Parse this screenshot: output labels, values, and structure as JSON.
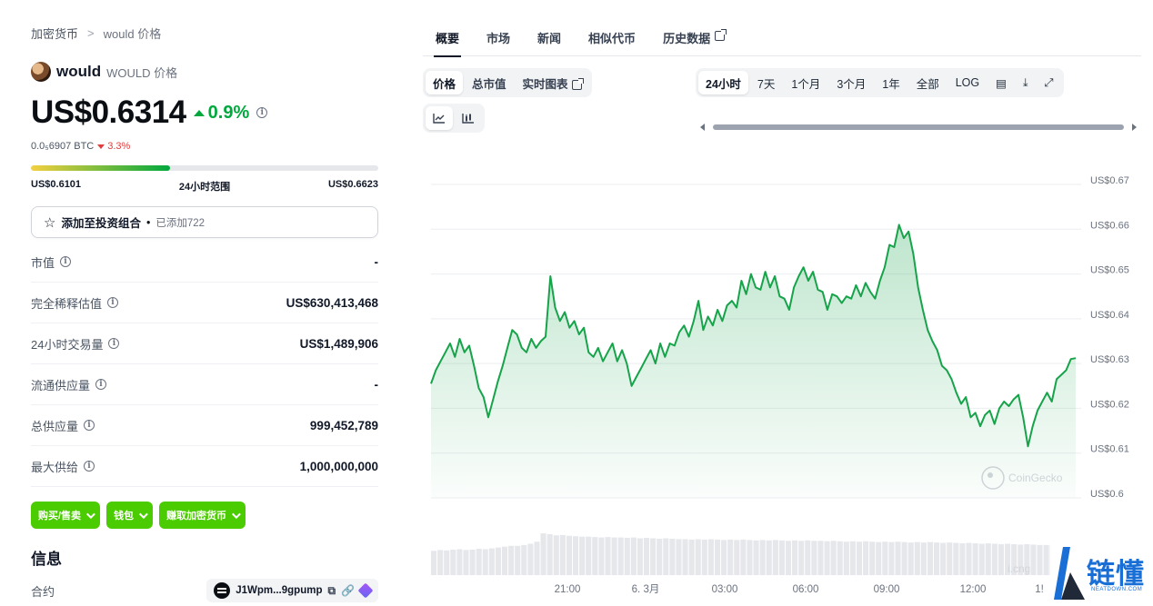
{
  "breadcrumb": {
    "root": "加密货币",
    "sep": ">",
    "current": "would 价格"
  },
  "coin": {
    "name": "would",
    "symbol": "WOULD 价格"
  },
  "price": {
    "value": "US$0.6314",
    "change": "0.9%",
    "btc_value": "0.0₅6907 BTC",
    "btc_change": "3.3%"
  },
  "range": {
    "low": "US$0.6101",
    "label": "24小时范围",
    "high": "US$0.6623",
    "position_pct": 40
  },
  "portfolio": {
    "label": "添加至投资组合",
    "dot": "•",
    "added": "已添加722"
  },
  "stats": [
    {
      "label": "市值",
      "value": "-"
    },
    {
      "label": "完全稀释估值",
      "value": "US$630,413,468"
    },
    {
      "label": "24小时交易量",
      "value": "US$1,489,906"
    },
    {
      "label": "流通供应量",
      "value": "-"
    },
    {
      "label": "总供应量",
      "value": "999,452,789"
    },
    {
      "label": "最大供给",
      "value": "1,000,000,000"
    }
  ],
  "actions": {
    "buy_sell": "购买/售卖",
    "wallet": "钱包",
    "earn": "赚取加密货币"
  },
  "info": {
    "title": "信息",
    "contract_label": "合约",
    "contract_value": "J1Wpm...9gpump"
  },
  "tabs": [
    {
      "label": "概要"
    },
    {
      "label": "市场"
    },
    {
      "label": "新闻"
    },
    {
      "label": "相似代币"
    },
    {
      "label": "历史数据"
    }
  ],
  "chart_modes": {
    "price": "价格",
    "market_cap": "总市值",
    "live": "实时图表"
  },
  "ranges": [
    "24小时",
    "7天",
    "1个月",
    "3个月",
    "1年",
    "全部",
    "LOG"
  ],
  "watermark": {
    "brand": "CoinGecko",
    "site": "链懂",
    "site_sub": "NEATDOWN.COM",
    "partial": "i.cng"
  },
  "colors": {
    "accent_green": "#00a83e",
    "button_green": "#4bcc00",
    "negative_red": "#e03e3e",
    "line_green": "#16a34a"
  },
  "chart_data": {
    "type": "area",
    "title": "",
    "ylim": [
      0.6,
      0.67
    ],
    "y_ticks": [
      "US$0.67",
      "US$0.66",
      "US$0.65",
      "US$0.64",
      "US$0.63",
      "US$0.62",
      "US$0.61",
      "US$0.6"
    ],
    "y_tick_values": [
      0.67,
      0.66,
      0.65,
      0.64,
      0.63,
      0.62,
      0.61,
      0.6
    ],
    "x_ticks": [
      "21:00",
      "6. 3月",
      "03:00",
      "06:00",
      "09:00",
      "12:00",
      "1!"
    ],
    "values": [
      0.6255,
      0.6285,
      0.6305,
      0.6325,
      0.6345,
      0.6315,
      0.6355,
      0.6325,
      0.634,
      0.6295,
      0.6245,
      0.6225,
      0.618,
      0.622,
      0.626,
      0.6295,
      0.6335,
      0.6375,
      0.6365,
      0.6335,
      0.6325,
      0.6355,
      0.6335,
      0.635,
      0.636,
      0.6495,
      0.6425,
      0.6395,
      0.6415,
      0.638,
      0.6395,
      0.6365,
      0.638,
      0.6325,
      0.6315,
      0.6335,
      0.6305,
      0.6325,
      0.6345,
      0.6305,
      0.633,
      0.63,
      0.625,
      0.627,
      0.629,
      0.631,
      0.633,
      0.63,
      0.6345,
      0.6315,
      0.6345,
      0.634,
      0.637,
      0.6385,
      0.636,
      0.6395,
      0.644,
      0.6375,
      0.6405,
      0.6385,
      0.642,
      0.6395,
      0.643,
      0.644,
      0.6425,
      0.6485,
      0.6455,
      0.65,
      0.647,
      0.6465,
      0.6505,
      0.647,
      0.6495,
      0.645,
      0.6445,
      0.642,
      0.647,
      0.6495,
      0.6515,
      0.6485,
      0.6505,
      0.6465,
      0.646,
      0.642,
      0.6455,
      0.645,
      0.6435,
      0.645,
      0.6445,
      0.6475,
      0.645,
      0.648,
      0.646,
      0.6445,
      0.6485,
      0.6515,
      0.6565,
      0.656,
      0.661,
      0.658,
      0.6595,
      0.6545,
      0.647,
      0.642,
      0.6375,
      0.635,
      0.633,
      0.6295,
      0.6285,
      0.6265,
      0.6235,
      0.621,
      0.6225,
      0.618,
      0.619,
      0.616,
      0.6185,
      0.6195,
      0.6165,
      0.62,
      0.6215,
      0.6205,
      0.622,
      0.623,
      0.618,
      0.6115,
      0.616,
      0.6195,
      0.6215,
      0.6235,
      0.6215,
      0.6265,
      0.6275,
      0.6285,
      0.631,
      0.6312
    ]
  },
  "volume_data": {
    "type": "bar",
    "note_levels": [
      0.58,
      0.6,
      0.59,
      0.61,
      0.62,
      0.6,
      0.61,
      0.63,
      0.62,
      0.64,
      0.66,
      0.68,
      0.7,
      0.7,
      0.72,
      0.75,
      0.8,
      1.0,
      0.98,
      0.95,
      0.96,
      0.94,
      0.93,
      0.92,
      0.92,
      0.91,
      0.9,
      0.91,
      0.9,
      0.9,
      0.89,
      0.9,
      0.88,
      0.89,
      0.88,
      0.87,
      0.88,
      0.87,
      0.86,
      0.86,
      0.85,
      0.86,
      0.85,
      0.86,
      0.85,
      0.84,
      0.85,
      0.84,
      0.85,
      0.84,
      0.83,
      0.84,
      0.83,
      0.84,
      0.83,
      0.82,
      0.83,
      0.82,
      0.83,
      0.82,
      0.82,
      0.81,
      0.82,
      0.81,
      0.8,
      0.81,
      0.8,
      0.81,
      0.8,
      0.79,
      0.8,
      0.79,
      0.8,
      0.79,
      0.78,
      0.79,
      0.78,
      0.79,
      0.78,
      0.77,
      0.78,
      0.77,
      0.76,
      0.77,
      0.76,
      0.75,
      0.76,
      0.75,
      0.74,
      0.75,
      0.74,
      0.73,
      0.74,
      0.73,
      0.72,
      0.72,
      0.71,
      0.72,
      0.71,
      0.7
    ]
  }
}
